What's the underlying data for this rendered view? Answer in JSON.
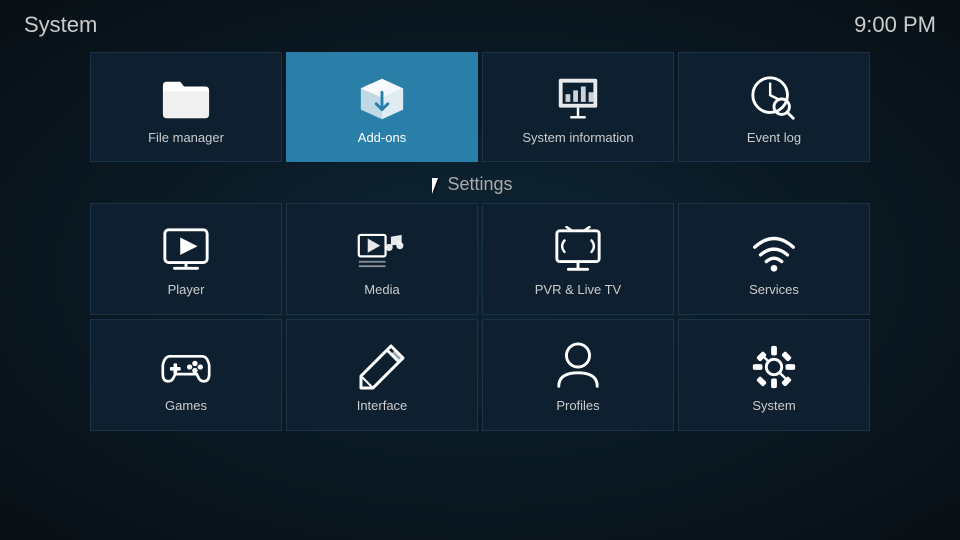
{
  "header": {
    "title": "System",
    "time": "9:00 PM"
  },
  "top_tiles": [
    {
      "id": "file-manager",
      "label": "File manager",
      "icon": "folder"
    },
    {
      "id": "add-ons",
      "label": "Add-ons",
      "icon": "box",
      "active": true
    },
    {
      "id": "system-information",
      "label": "System information",
      "icon": "chart"
    },
    {
      "id": "event-log",
      "label": "Event log",
      "icon": "clock-search"
    }
  ],
  "settings_section": {
    "title": "Settings"
  },
  "settings_row1": [
    {
      "id": "player",
      "label": "Player",
      "icon": "play"
    },
    {
      "id": "media",
      "label": "Media",
      "icon": "media"
    },
    {
      "id": "pvr-live-tv",
      "label": "PVR & Live TV",
      "icon": "tv"
    },
    {
      "id": "services",
      "label": "Services",
      "icon": "wifi"
    }
  ],
  "settings_row2": [
    {
      "id": "games",
      "label": "Games",
      "icon": "gamepad"
    },
    {
      "id": "interface",
      "label": "Interface",
      "icon": "edit"
    },
    {
      "id": "profiles",
      "label": "Profiles",
      "icon": "person"
    },
    {
      "id": "system",
      "label": "System",
      "icon": "settings"
    }
  ]
}
